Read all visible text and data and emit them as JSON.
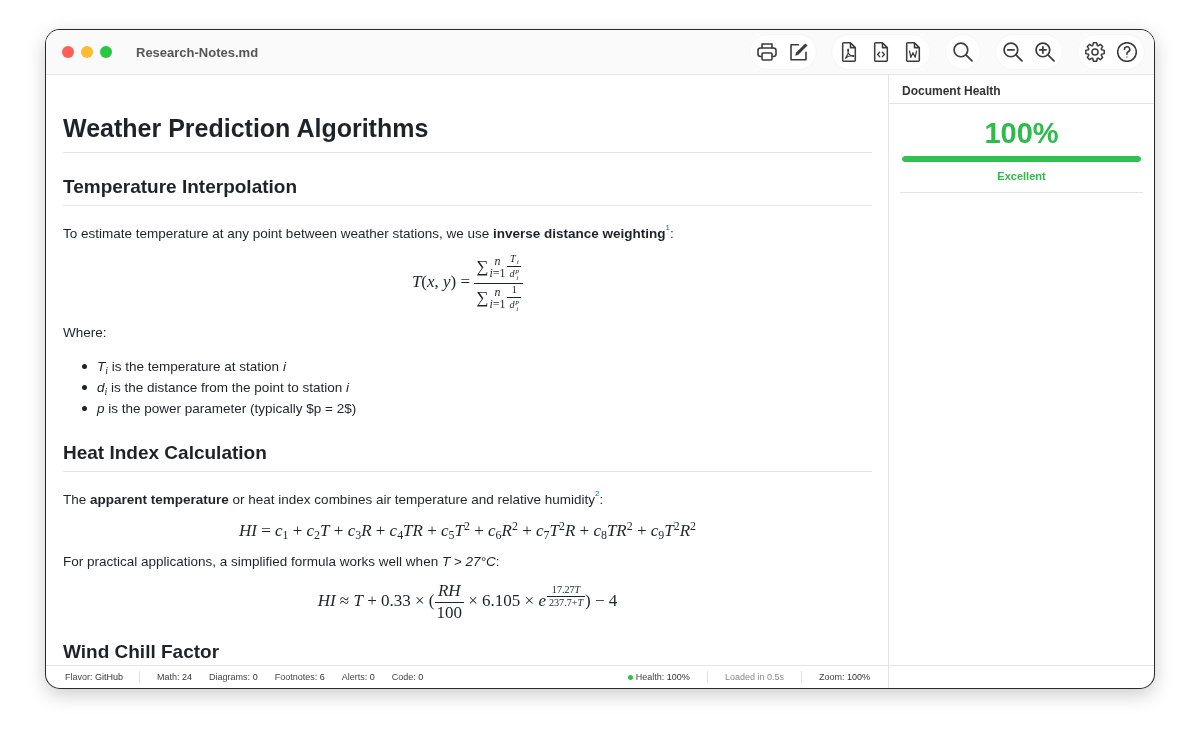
{
  "window": {
    "title": "Research-Notes.md"
  },
  "toolbar": {
    "groups": [
      {
        "buttons": [
          {
            "kind": "print"
          },
          {
            "kind": "edit"
          }
        ]
      },
      {
        "buttons": [
          {
            "kind": "pdf"
          },
          {
            "kind": "html"
          },
          {
            "kind": "word"
          }
        ]
      },
      {
        "buttons": [
          {
            "kind": "search"
          }
        ]
      },
      {
        "buttons": [
          {
            "kind": "zoom_out"
          },
          {
            "kind": "zoom_in"
          }
        ]
      },
      {
        "buttons": [
          {
            "kind": "settings"
          },
          {
            "kind": "help"
          }
        ]
      }
    ]
  },
  "document": {
    "blocks": [
      {
        "kind": "h1",
        "text": "Weather Prediction Algorithms"
      },
      {
        "kind": "h2",
        "text": "Temperature Interpolation"
      },
      {
        "kind": "paragraph",
        "text": "To estimate temperature at any point between weather stations, we use **inverse distance weighting**$^{1}$:"
      },
      {
        "kind": "math",
        "parts": [
          {
            "kind": "text",
            "text": "*T*(*x*, *y*) = "
          },
          {
            "kind": "frac",
            "num": [
              {
                "kind": "script",
                "base": "∑",
                "sub": [
                  {
                    "kind": "text",
                    "text": "*i*=1"
                  }
                ],
                "sup": [
                  {
                    "kind": "text",
                    "text": "*n*"
                  }
                ]
              },
              {
                "kind": "frac",
                "num": [
                  {
                    "kind": "script",
                    "base": "*T*",
                    "sub": [
                      {
                        "kind": "text",
                        "text": "*i*"
                      }
                    ]
                  }
                ],
                "den": [
                  {
                    "kind": "script",
                    "base": "*d*",
                    "sub": [
                      {
                        "kind": "text",
                        "text": "*i*"
                      }
                    ],
                    "sup": [
                      {
                        "kind": "text",
                        "text": "*p*"
                      }
                    ]
                  }
                ]
              }
            ],
            "den": [
              {
                "kind": "script",
                "base": "∑",
                "sub": [
                  {
                    "kind": "text",
                    "text": "*i*=1"
                  }
                ],
                "sup": [
                  {
                    "kind": "text",
                    "text": "*n*"
                  }
                ]
              },
              {
                "kind": "frac",
                "num": [
                  {
                    "kind": "text",
                    "text": "1"
                  }
                ],
                "den": [
                  {
                    "kind": "script",
                    "base": "*d*",
                    "sub": [
                      {
                        "kind": "text",
                        "text": "*i*"
                      }
                    ],
                    "sup": [
                      {
                        "kind": "text",
                        "text": "*p*"
                      }
                    ]
                  }
                ]
              }
            ]
          }
        ]
      },
      {
        "kind": "paragraph",
        "text": "Where:"
      },
      {
        "kind": "list",
        "items": [
          "*T*$_{i}$ is the temperature at station *i*",
          "*d*$_{i}$ is the distance from the point to station *i*",
          "*p* is the power parameter (typically $p = 2$)"
        ]
      },
      {
        "kind": "h2",
        "text": "Heat Index Calculation"
      },
      {
        "kind": "paragraph",
        "text": "The **apparent temperature** or heat index combines air temperature and relative humidity$^{2}$:"
      },
      {
        "kind": "math",
        "parts": [
          {
            "kind": "text",
            "text": "*HI* = *c*$_{1}$ + *c*$_{2}$*T* + *c*$_{3}$*R* + *c*$_{4}$*TR* + *c*$_{5}$*T*$^{2}$ + *c*$_{6}$*R*$^{2}$ + *c*$_{7}$*T*$^{2}$*R* + *c*$_{8}$*TR*$^{2}$ + *c*$_{9}$*T*$^{2}$*R*$^{2}$"
          }
        ]
      },
      {
        "kind": "paragraph",
        "text": "For practical applications, a simplified formula works well when *T* > *27°C*:"
      },
      {
        "kind": "math",
        "parts": [
          {
            "kind": "text",
            "text": "*HI* ≈ *T* + 0.33 × ("
          },
          {
            "kind": "frac",
            "num": [
              {
                "kind": "text",
                "text": "*RH*"
              }
            ],
            "den": [
              {
                "kind": "text",
                "text": "100"
              }
            ]
          },
          {
            "kind": "text",
            "text": " × 6.105 × "
          },
          {
            "kind": "script",
            "base": "*e*",
            "sup": [
              {
                "kind": "frac",
                "num": [
                  {
                    "kind": "text",
                    "text": "17.27"
                  },
                  {
                    "kind": "text",
                    "text": "*T*"
                  }
                ],
                "den": [
                  {
                    "kind": "text",
                    "text": "237.7+*T*"
                  }
                ]
              }
            ]
          },
          {
            "kind": "text",
            "text": ") − 4"
          }
        ]
      },
      {
        "kind": "h2",
        "text": "Wind Chill Factor"
      }
    ]
  },
  "status_bar": {
    "stats": [
      {
        "label": "Flavor:",
        "value": "GitHub"
      },
      {
        "label": "Math:",
        "value": "24"
      },
      {
        "label": "Diagrams:",
        "value": "0"
      },
      {
        "label": "Footnotes:",
        "value": "6"
      },
      {
        "label": "Alerts:",
        "value": "0"
      },
      {
        "label": "Code:",
        "value": "0"
      }
    ],
    "health": {
      "label": "Health:",
      "value": "100%"
    },
    "load_time": "Loaded in 0.5s",
    "zoom": {
      "label": "Zoom:",
      "value": "100%"
    }
  },
  "health_panel": {
    "title": "Document Health",
    "score": "100%",
    "level": 1.0,
    "rating": "Excellent"
  }
}
